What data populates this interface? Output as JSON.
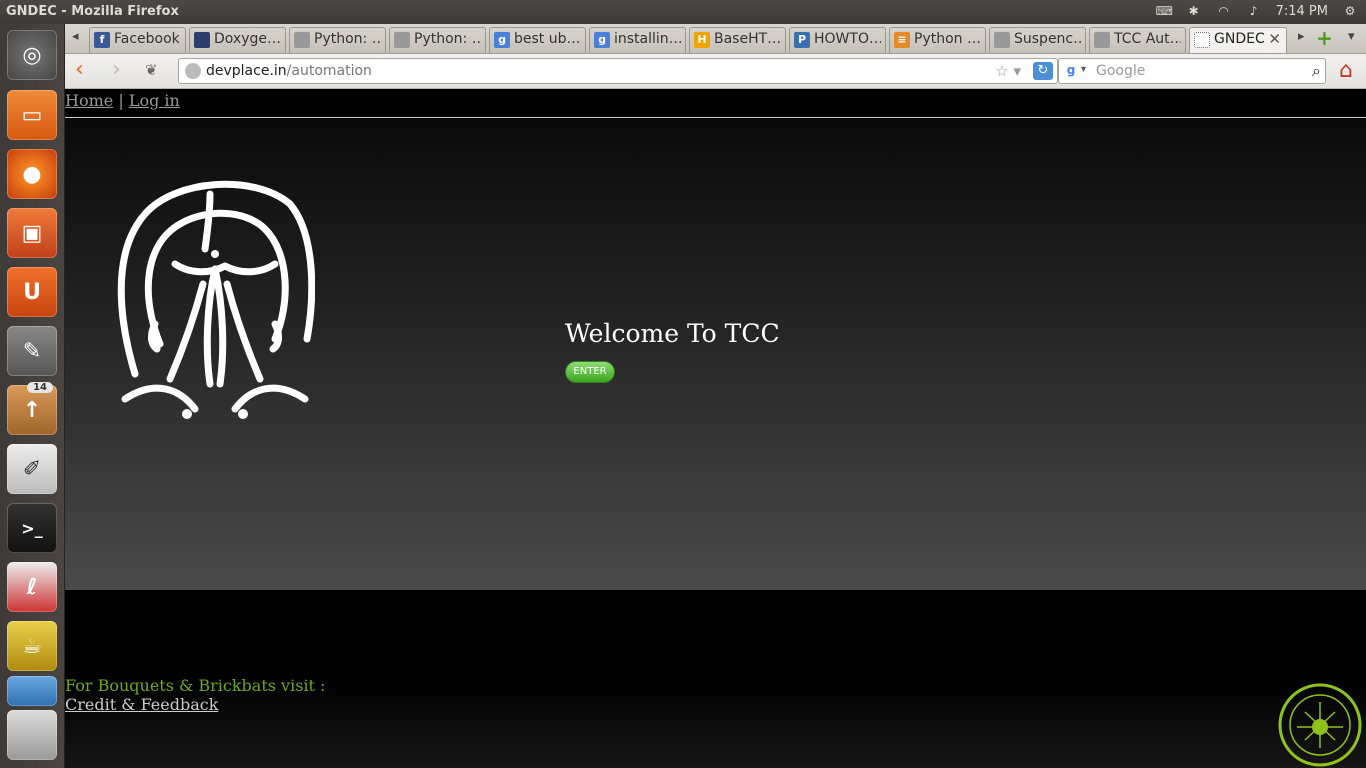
{
  "window": {
    "title": "GNDEC - Mozilla Firefox"
  },
  "tray": {
    "time": "7:14 PM"
  },
  "launcher": {
    "badge_count": "14"
  },
  "tabs": [
    {
      "label": "Facebook",
      "fav": "f",
      "fav_color": "#3b5998"
    },
    {
      "label": "Doxyge…",
      "fav": "",
      "fav_color": "#2c3e6b"
    },
    {
      "label": "Python: …",
      "fav": "",
      "fav_color": "#999999"
    },
    {
      "label": "Python: …",
      "fav": "",
      "fav_color": "#999999"
    },
    {
      "label": "best ub…",
      "fav": "g",
      "fav_color": "#4a7fdc"
    },
    {
      "label": "installin…",
      "fav": "g",
      "fav_color": "#4a7fdc"
    },
    {
      "label": "BaseHT…",
      "fav": "H",
      "fav_color": "#f0a400"
    },
    {
      "label": "HOWTO…",
      "fav": "P",
      "fav_color": "#3a6fb0"
    },
    {
      "label": "Python …",
      "fav": "≡",
      "fav_color": "#e48a2b"
    },
    {
      "label": "Suspenc…",
      "fav": "",
      "fav_color": "#999999"
    },
    {
      "label": "TCC Aut…",
      "fav": "",
      "fav_color": "#999999"
    },
    {
      "label": "GNDEC",
      "fav": "",
      "fav_color": "#ffffff"
    }
  ],
  "navbar": {
    "url_host": "devplace.in",
    "url_path": "/automation",
    "search_placeholder": "Google"
  },
  "page": {
    "nav": {
      "home": "Home",
      "separator": "|",
      "login": "Log in"
    },
    "welcome": "Welcome To TCC",
    "enter_label": "ENTER",
    "footer_message": "For Bouquets & Brickbats visit :",
    "footer_link": "Credit & Feedback"
  }
}
